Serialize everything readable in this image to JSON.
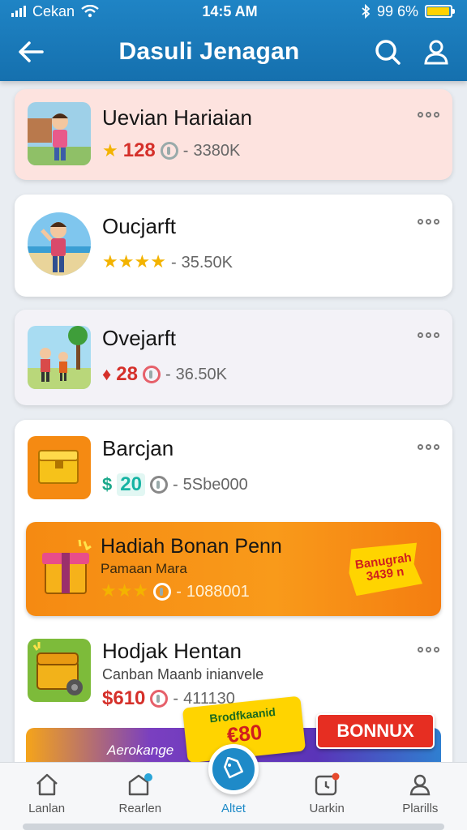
{
  "status": {
    "carrier": "Cekan",
    "time": "14:5 AM",
    "battery": "99 6%",
    "battery_level": 0.96
  },
  "header": {
    "title": "Dasuli Jenagan"
  },
  "items": [
    {
      "title": "Uevian Hariaian",
      "price": "128",
      "count": "3380K",
      "bg": "#fde3df"
    },
    {
      "title": "Oucjarft",
      "price": "",
      "count": "35.50K",
      "rating": 4
    },
    {
      "title": "Ovejarft",
      "price": "28",
      "count": "36.50K",
      "bg": "#f3f2f7"
    },
    {
      "title": "Barcjan",
      "price": "20",
      "count": "5Sbe000"
    },
    {
      "title": "Hadiah Bonan Penn",
      "subtitle": "Pamaan Mara",
      "count": "1088001",
      "badge": "Banugrah 3439 n",
      "rating": 3
    },
    {
      "title": "Hodjak Hentan",
      "subtitle": "Canban Maanb inianvele",
      "price": "$610",
      "count": "411130"
    }
  ],
  "promo": {
    "left_label": "Aerokange",
    "mid_top": "Brodfkaanid",
    "mid_price": "€80",
    "bonus": "BONNUX"
  },
  "nav": [
    {
      "label": "Lanlan"
    },
    {
      "label": "Rearlen"
    },
    {
      "label": "Altet"
    },
    {
      "label": "Uarkin"
    },
    {
      "label": "Plarills"
    }
  ],
  "colors": {
    "accent": "#1e8ac8",
    "orange": "#f28a12",
    "promo_yellow": "#ffd400",
    "bonus_red": "#e62e22"
  }
}
